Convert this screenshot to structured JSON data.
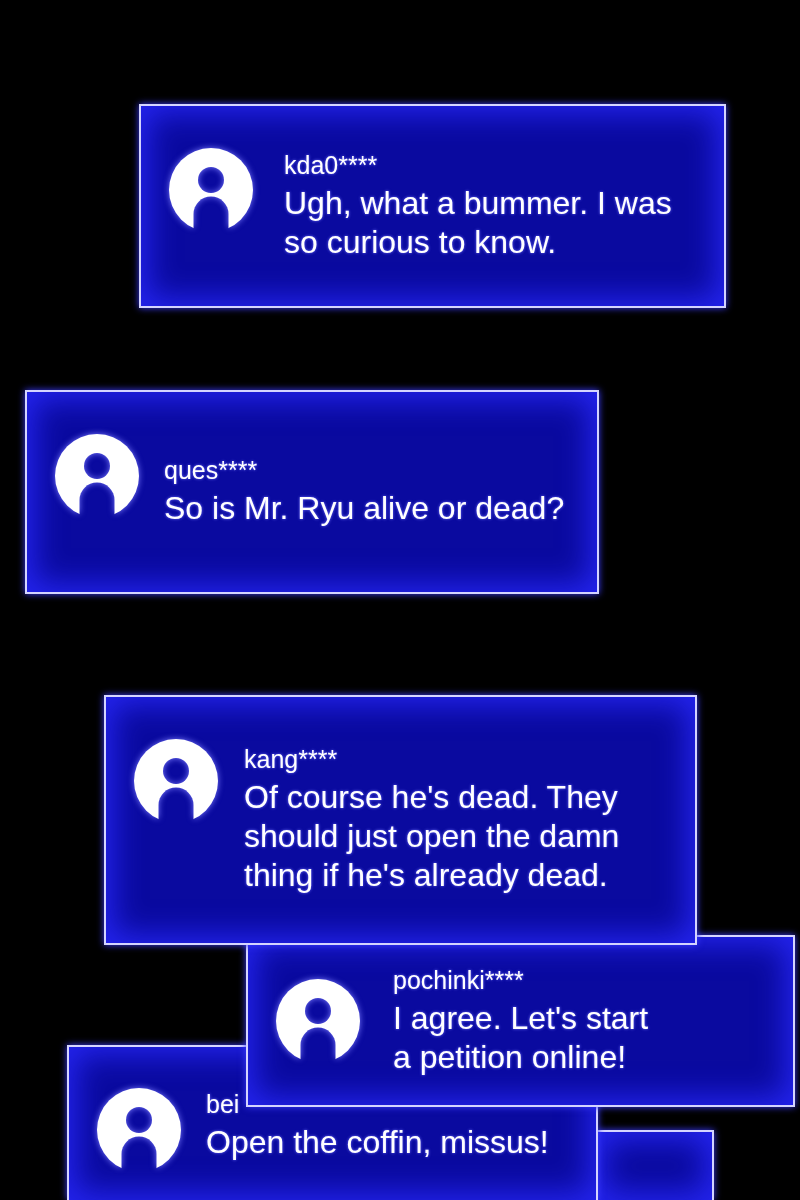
{
  "comments": [
    {
      "username": "kda0****",
      "message": "Ugh, what a bummer. I was so curious to know."
    },
    {
      "username": "ques****",
      "message": "So is Mr. Ryu alive or dead?"
    },
    {
      "username": "kang****",
      "message": "Of course he's dead. They should just open the damn thing if he's already dead."
    },
    {
      "username": "pochinki****",
      "message": "I agree. Let's start a petition online!"
    },
    {
      "username": "bei",
      "message": "Open the coffin, missus!"
    }
  ]
}
